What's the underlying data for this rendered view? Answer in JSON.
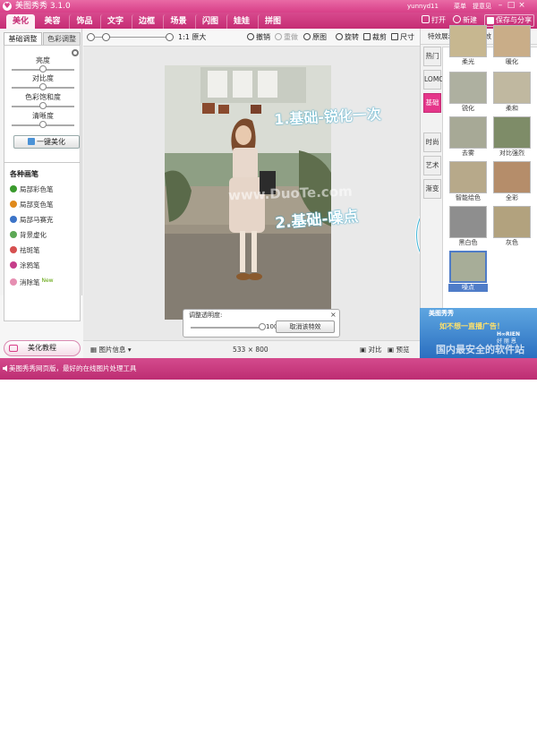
{
  "window": {
    "title": "美图秀秀 3.1.0",
    "user": "yunnyd11",
    "menu_link": "菜单",
    "feedback_link": "提意见"
  },
  "menubar": {
    "tabs": [
      {
        "label": "美化",
        "active": true
      },
      {
        "label": "美容"
      },
      {
        "label": "饰品"
      },
      {
        "label": "文字"
      },
      {
        "label": "边框"
      },
      {
        "label": "场景"
      },
      {
        "label": "闪图"
      },
      {
        "label": "娃娃"
      },
      {
        "label": "拼图"
      }
    ],
    "open_label": "打开",
    "new_label": "新建",
    "save_label": "保存与分享"
  },
  "left_panel": {
    "tabs": [
      "基础调整",
      "色彩调整"
    ],
    "sliders": [
      {
        "label": "亮度",
        "value": 0.5
      },
      {
        "label": "对比度",
        "value": 0.5
      },
      {
        "label": "色彩饱和度",
        "value": 0.5
      },
      {
        "label": "清晰度",
        "value": 0.5
      }
    ],
    "one_click_label": "一键美化",
    "brushes_title": "各种画笔",
    "brushes": [
      {
        "label": "局部彩色笔",
        "color": "#3a9a2d"
      },
      {
        "label": "局部变色笔",
        "color": "#e08a1c"
      },
      {
        "label": "局部马赛克",
        "color": "#3c74c8"
      },
      {
        "label": "背景虚化",
        "color": "#5ca855"
      },
      {
        "label": "祛斑笔",
        "color": "#d65050"
      },
      {
        "label": "涂鸦笔",
        "color": "#c63e8a"
      },
      {
        "label": "消除笔",
        "color": "#e68fb2",
        "tag": "New"
      }
    ],
    "tutorial_label": "美化教程"
  },
  "toolbar": {
    "zoom_label": "1:1 原大",
    "undo_label": "撤销",
    "redo_label": "重做",
    "original_label": "原图",
    "rotate_label": "旋转",
    "crop_label": "裁剪",
    "size_label": "尺寸"
  },
  "canvas": {
    "watermark": "www.DuoTe.com",
    "opacity_title": "调整透明度:",
    "opacity_value": "100%",
    "opacity_level": 1.0,
    "cancel_effect_label": "取消该特效"
  },
  "annotations": {
    "step1": "1.基础-锐化一次",
    "step2": "2.基础-噪点"
  },
  "status": {
    "image_info": "图片信息",
    "size": "533 × 800",
    "compare": "对比",
    "preview": "预览"
  },
  "right_panel": {
    "breadcrumb": "特效展示 > 基础特效",
    "tabs": [
      "热门",
      "LOMO",
      "基础",
      "时尚",
      "艺术",
      "渐变"
    ],
    "active_tab_index": 2,
    "effects": [
      {
        "label": "柔光"
      },
      {
        "label": "暖化"
      },
      {
        "label": "锐化"
      },
      {
        "label": "柔和"
      },
      {
        "label": "去雾"
      },
      {
        "label": "对比强烈"
      },
      {
        "label": "智能绘色"
      },
      {
        "label": "全彩"
      },
      {
        "label": "黑白色"
      },
      {
        "label": "灰色"
      },
      {
        "label": "噪点",
        "selected": true
      }
    ]
  },
  "ad": {
    "line1": "美图秀秀",
    "line2": "如不想一直播广告！",
    "brand": "H∞RIEN",
    "brand2": "好 丽 恩",
    "watermark": "国内最安全的软件站"
  },
  "bottom": {
    "message": "美图秀秀网页版，最好的在线图片处理工具"
  },
  "colors": {
    "accent": "#d83f88",
    "selected": "#4f7cc8"
  }
}
